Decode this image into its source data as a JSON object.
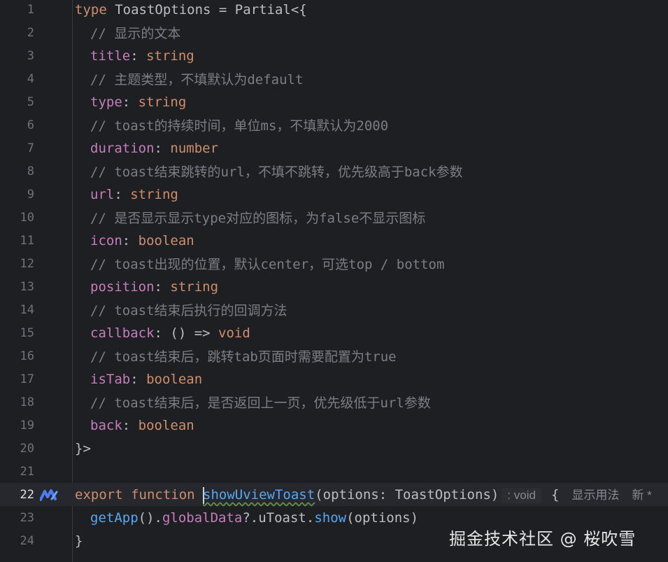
{
  "lines": [
    {
      "n": "1"
    },
    {
      "n": "2"
    },
    {
      "n": "3"
    },
    {
      "n": "4"
    },
    {
      "n": "5"
    },
    {
      "n": "6"
    },
    {
      "n": "7"
    },
    {
      "n": "8"
    },
    {
      "n": "9"
    },
    {
      "n": "10"
    },
    {
      "n": "11"
    },
    {
      "n": "12"
    },
    {
      "n": "13"
    },
    {
      "n": "14"
    },
    {
      "n": "15"
    },
    {
      "n": "16"
    },
    {
      "n": "17"
    },
    {
      "n": "18"
    },
    {
      "n": "19"
    },
    {
      "n": "20"
    },
    {
      "n": "21"
    },
    {
      "n": "22"
    },
    {
      "n": "23"
    },
    {
      "n": "24"
    }
  ],
  "code": {
    "l1_kw": "type",
    "l1_rest": " ToastOptions = Partial<{",
    "l2": "// 显示的文本",
    "l3_prop": "title",
    "l3_colon": ": ",
    "l3_type": "string",
    "l4": "// 主题类型，不填默认为default",
    "l5_prop": "type",
    "l5_colon": ": ",
    "l5_type": "string",
    "l6": "// toast的持续时间，单位ms，不填默认为2000",
    "l7_prop": "duration",
    "l7_colon": ": ",
    "l7_type": "number",
    "l8": "// toast结束跳转的url，不填不跳转，优先级高于back参数",
    "l9_prop": "url",
    "l9_colon": ": ",
    "l9_type": "string",
    "l10": "// 是否显示显示type对应的图标，为false不显示图标",
    "l11_prop": "icon",
    "l11_colon": ": ",
    "l11_type": "boolean",
    "l12": "// toast出现的位置，默认center，可选top / bottom",
    "l13_prop": "position",
    "l13_colon": ": ",
    "l13_type": "string",
    "l14": "// toast结束后执行的回调方法",
    "l15_prop": "callback",
    "l15_mid": ": () => ",
    "l15_type": "void",
    "l16": "// toast结束后，跳转tab页面时需要配置为true",
    "l17_prop": "isTab",
    "l17_colon": ": ",
    "l17_type": "boolean",
    "l18": "// toast结束后，是否返回上一页，优先级低于url参数",
    "l19_prop": "back",
    "l19_colon": ": ",
    "l19_type": "boolean",
    "l20": "}>",
    "l22_export": "export",
    "l22_function": " function ",
    "l22_name": "showUviewToast",
    "l22_rest": "(options: ToastOptions)",
    "l22_hint": ": void",
    "l22_brace": "{",
    "l22_usage": "显示用法",
    "l22_new": "新 *",
    "l23_fn1": "getApp",
    "l23_p1": "().",
    "l23_prop": "globalData",
    "l23_p2": "?.uToast.",
    "l23_fn2": "show",
    "l23_p3": "(options)",
    "l24": "}"
  },
  "icons": {
    "ai_assist": "ai-assistant-icon"
  },
  "colors": {
    "background": "#1e1f22",
    "keyword": "#cf8e6d",
    "property": "#c77dbb",
    "comment": "#7a7e85",
    "function": "#56a8f5",
    "text": "#bcbec4"
  },
  "watermark": "掘金技术社区 @ 桜吹雪"
}
